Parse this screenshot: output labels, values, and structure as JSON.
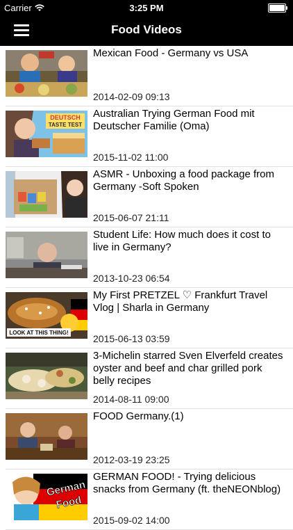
{
  "status": {
    "carrier": "Carrier",
    "time": "3:25 PM",
    "battery_level": 1.0
  },
  "nav": {
    "title": "Food Videos",
    "menu_icon": "hamburger-menu-icon"
  },
  "videos": [
    {
      "title": "Mexican Food - Germany vs USA",
      "date": "2014-02-09 09:13"
    },
    {
      "title": "Australian Trying German Food mit Deutscher Familie (Oma)",
      "date": "2015-11-02 11:00"
    },
    {
      "title": "ASMR -  Unboxing a food package from Germany -Soft Spoken",
      "date": "2015-06-07 21:11"
    },
    {
      "title": "Student Life: How much does it cost to live in Germany?",
      "date": "2013-10-23 06:54"
    },
    {
      "title": "My First PRETZEL ♡ Frankfurt Travel Vlog | Sharla in Germany",
      "date": "2015-06-13 03:59"
    },
    {
      "title": "3-Michelin starred Sven Elverfeld creates oyster and beef and char grilled pork belly recipes",
      "date": "2014-08-11 09:00"
    },
    {
      "title": "FOOD Germany.(1)",
      "date": "2012-03-19 23:25"
    },
    {
      "title": "GERMAN FOOD! -  Trying delicious snacks from Germany (ft. theNEONblog)",
      "date": "2015-09-02 14:00"
    }
  ],
  "thumbnail_text": {
    "t2_line1": "DEUTSCH",
    "t2_line2": "TASTE TEST",
    "t5_caption": "LOOK AT THIS THING!",
    "t8_line1": "German",
    "t8_line2": "Food"
  }
}
